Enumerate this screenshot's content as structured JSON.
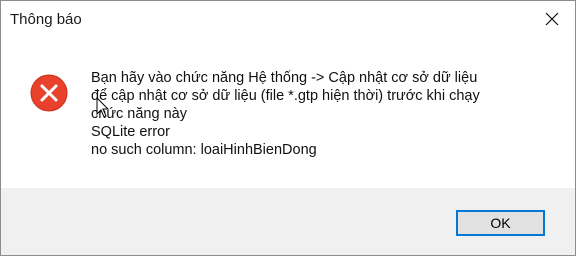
{
  "window": {
    "title": "Thông báo",
    "close_icon": "close-icon"
  },
  "message": {
    "icon": "error-icon",
    "lines": [
      "Bạn hãy vào chức năng Hệ thống -> Cập nhật cơ sở dữ liệu",
      "để cập nhật cơ sở dữ liệu (file *.gtp hiện thời) trước khi chạy",
      "chức năng này",
      "SQLite error",
      "no such column: loaiHinhBienDong"
    ]
  },
  "buttons": {
    "ok_label": "OK"
  },
  "colors": {
    "error_red": "#e8412c",
    "focus_border": "#0078d7",
    "footer_bg": "#f0f0f0"
  }
}
